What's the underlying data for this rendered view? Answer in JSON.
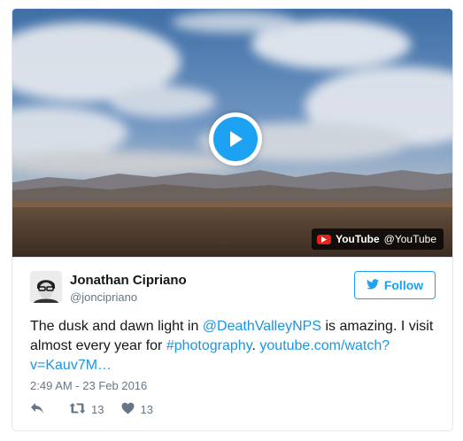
{
  "video": {
    "play_icon": "play-icon",
    "badge_brand": "YouTube",
    "badge_handle": "@YouTube",
    "brand_color": "#e62117"
  },
  "tweet": {
    "author_name": "Jonathan Cipriano",
    "author_handle": "@joncipriano",
    "follow_label": "Follow",
    "text_before": "The dusk and dawn light in ",
    "mention": "@DeathValleyNPS",
    "text_middle": " is amazing. I visit almost every year for ",
    "hashtag": "#photography",
    "text_after": ". ",
    "url": "youtube.com/watch?v=Kauv7M…",
    "timestamp": "2:49 AM - 23 Feb 2016",
    "retweet_count": "13",
    "like_count": "13"
  },
  "colors": {
    "accent": "#1da1f2",
    "link": "#1b95e0",
    "muted": "#657786",
    "text": "#14171a"
  }
}
